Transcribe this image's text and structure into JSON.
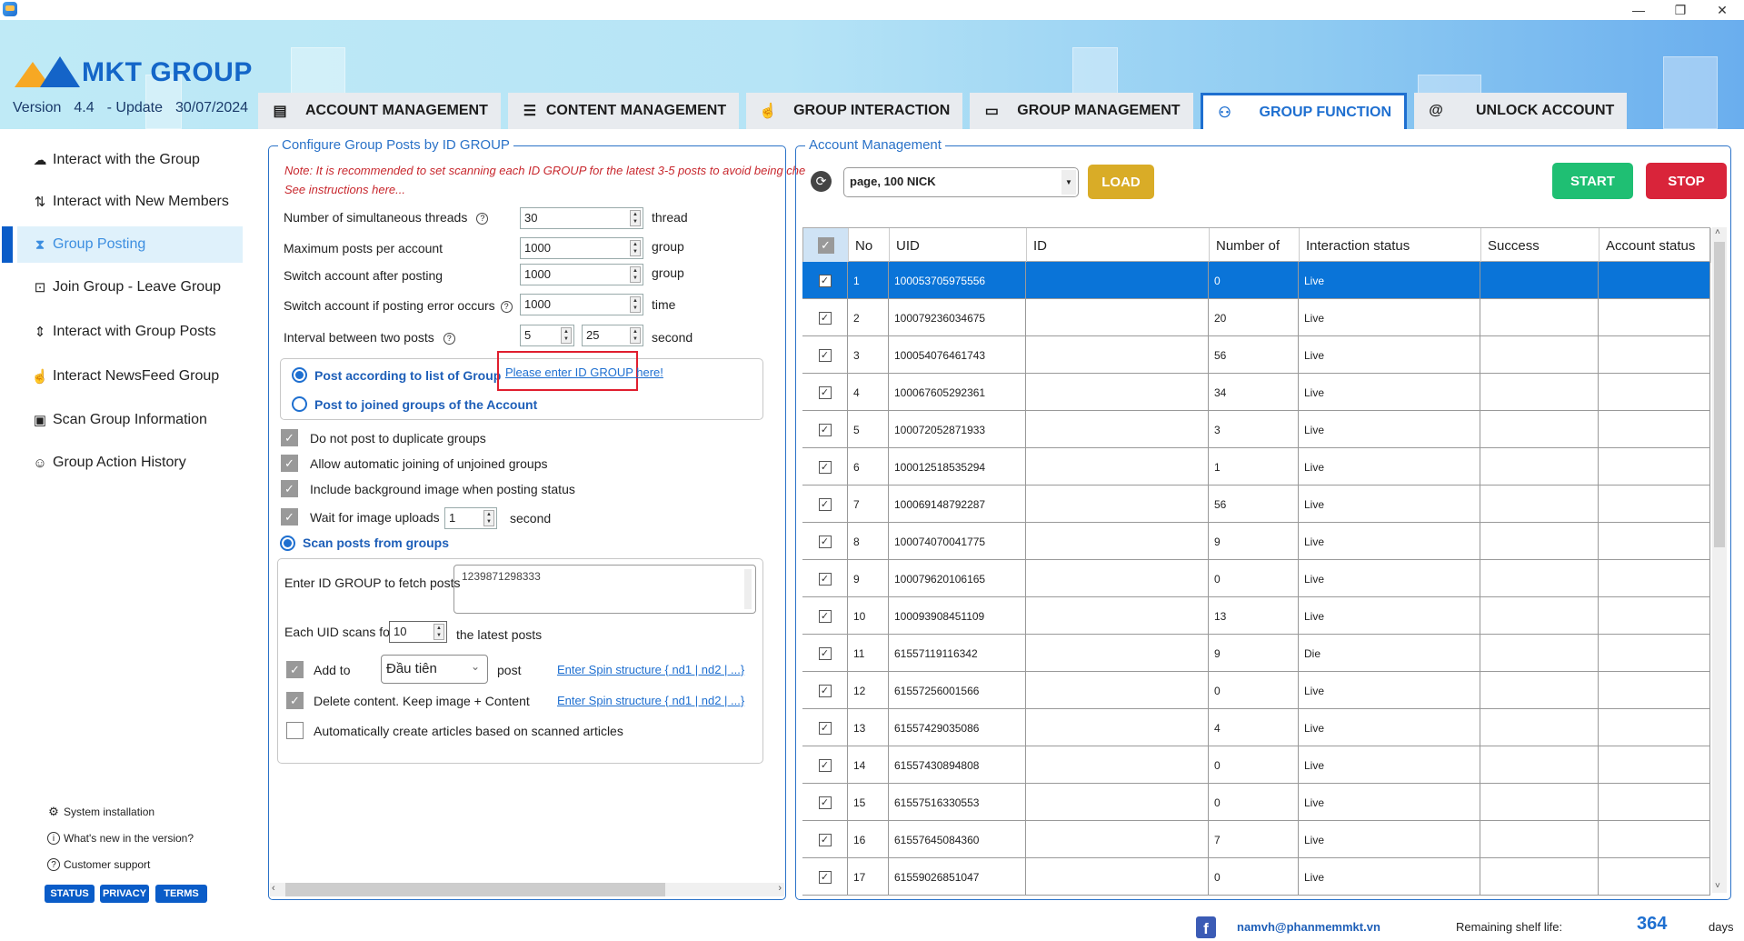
{
  "window": {
    "minimize": "—",
    "restore": "❐",
    "close": "✕"
  },
  "header": {
    "logo_text": "MKT GROUP",
    "version_label": "Version",
    "version": "4.4",
    "update_label": "- Update",
    "update_date": "30/07/2024"
  },
  "tabs": [
    {
      "label": "ACCOUNT MANAGEMENT",
      "icon": "▤"
    },
    {
      "label": "CONTENT MANAGEMENT",
      "icon": "☰"
    },
    {
      "label": "GROUP INTERACTION",
      "icon": "☝"
    },
    {
      "label": "GROUP MANAGEMENT",
      "icon": "▭"
    },
    {
      "label": "GROUP FUNCTION",
      "icon": "⚇",
      "active": true
    },
    {
      "label": "UNLOCK ACCOUNT",
      "icon": "@"
    }
  ],
  "sidebar": {
    "items": [
      {
        "label": "Interact with the Group",
        "icon": "☁"
      },
      {
        "label": "Interact with New Members",
        "icon": "⇅"
      },
      {
        "label": "Group Posting",
        "icon": "⧗",
        "active": true
      },
      {
        "label": "Join Group - Leave Group",
        "icon": "⊡"
      },
      {
        "label": "Interact with Group Posts",
        "icon": "⇕"
      },
      {
        "label": "Interact NewsFeed Group",
        "icon": "☝"
      },
      {
        "label": "Scan Group Information",
        "icon": "▣"
      },
      {
        "label": "Group Action History",
        "icon": "☺"
      }
    ],
    "footer": [
      {
        "label": "System installation",
        "icon": "⚙"
      },
      {
        "label": "What's new in the version?",
        "icon": "i"
      },
      {
        "label": "Customer support",
        "icon": "?"
      }
    ],
    "pills": [
      "STATUS",
      "PRIVACY",
      "TERMS"
    ]
  },
  "config": {
    "legend": "Configure Group Posts by ID GROUP",
    "note": "Note: It is recommended to set scanning each ID GROUP for the latest 3-5 posts to avoid being che",
    "instructions": "See instructions here...",
    "fields": {
      "threads": {
        "label": "Number of simultaneous threads",
        "value": "30",
        "unit": "thread"
      },
      "max_posts": {
        "label": "Maximum posts per account",
        "value": "1000",
        "unit": "group"
      },
      "switch_after": {
        "label": "Switch account after posting",
        "value": "1000",
        "unit": "group"
      },
      "switch_error": {
        "label": "Switch account if posting error occurs",
        "value": "1000",
        "unit": "time"
      },
      "interval": {
        "label": "Interval between two posts",
        "from": "5",
        "to": "25",
        "unit": "second"
      }
    },
    "post_mode": {
      "option1": "Post according to list of Group",
      "option2": "Post to joined groups of the Account",
      "enter_link": "Please enter ID GROUP here!",
      "selected": "option1"
    },
    "checks": {
      "no_duplicate": {
        "label": "Do not post to duplicate groups",
        "checked": true
      },
      "auto_join": {
        "label": "Allow automatic joining of unjoined groups",
        "checked": true
      },
      "bg_image": {
        "label": "Include background image when posting status",
        "checked": true
      },
      "wait_upload": {
        "label": "Wait for image uploads",
        "value": "1",
        "unit": "second",
        "checked": true
      }
    },
    "scan": {
      "label": "Scan posts from groups",
      "fetch_label": "Enter ID GROUP to fetch posts",
      "fetch_value": "1239871298333",
      "each_uid_label": "Each UID scans for",
      "each_uid_value": "10",
      "each_uid_unit": "the latest posts",
      "add_to_label": "Add to",
      "add_to_value": "Đầu tiên",
      "add_to_unit": "post",
      "spin_link": "Enter Spin structure { nd1 | nd2 | ...}",
      "delete_label": "Delete content. Keep image + Content",
      "auto_create_label": "Automatically create articles based on scanned articles"
    }
  },
  "accounts": {
    "legend": "Account Management",
    "dropdown_value": "page, 100 NICK",
    "load": "LOAD",
    "start": "START",
    "stop": "STOP",
    "colors": {
      "load": "#d9ac27",
      "start": "#1fbf73",
      "stop": "#d9243a",
      "selected_row": "#0a74d8"
    },
    "columns": [
      "",
      "No",
      "UID",
      "ID",
      "Number of",
      "Interaction status",
      "Success",
      "Account status"
    ],
    "rows": [
      {
        "no": "1",
        "uid": "100053705975556",
        "id": "",
        "count": "0",
        "status": "Live",
        "success": "",
        "account": "",
        "selected": true
      },
      {
        "no": "2",
        "uid": "100079236034675",
        "id": "",
        "count": "20",
        "status": "Live",
        "success": "",
        "account": ""
      },
      {
        "no": "3",
        "uid": "100054076461743",
        "id": "",
        "count": "56",
        "status": "Live",
        "success": "",
        "account": ""
      },
      {
        "no": "4",
        "uid": "100067605292361",
        "id": "",
        "count": "34",
        "status": "Live",
        "success": "",
        "account": ""
      },
      {
        "no": "5",
        "uid": "100072052871933",
        "id": "",
        "count": "3",
        "status": "Live",
        "success": "",
        "account": ""
      },
      {
        "no": "6",
        "uid": "100012518535294",
        "id": "",
        "count": "1",
        "status": "Live",
        "success": "",
        "account": ""
      },
      {
        "no": "7",
        "uid": "100069148792287",
        "id": "",
        "count": "56",
        "status": "Live",
        "success": "",
        "account": ""
      },
      {
        "no": "8",
        "uid": "100074070041775",
        "id": "",
        "count": "9",
        "status": "Live",
        "success": "",
        "account": ""
      },
      {
        "no": "9",
        "uid": "100079620106165",
        "id": "",
        "count": "0",
        "status": "Live",
        "success": "",
        "account": ""
      },
      {
        "no": "10",
        "uid": "100093908451109",
        "id": "",
        "count": "13",
        "status": "Live",
        "success": "",
        "account": ""
      },
      {
        "no": "11",
        "uid": "61557119116342",
        "id": "",
        "count": "9",
        "status": "Die",
        "success": "",
        "account": ""
      },
      {
        "no": "12",
        "uid": "61557256001566",
        "id": "",
        "count": "0",
        "status": "Live",
        "success": "",
        "account": ""
      },
      {
        "no": "13",
        "uid": "61557429035086",
        "id": "",
        "count": "4",
        "status": "Live",
        "success": "",
        "account": ""
      },
      {
        "no": "14",
        "uid": "61557430894808",
        "id": "",
        "count": "0",
        "status": "Live",
        "success": "",
        "account": ""
      },
      {
        "no": "15",
        "uid": "61557516330553",
        "id": "",
        "count": "0",
        "status": "Live",
        "success": "",
        "account": ""
      },
      {
        "no": "16",
        "uid": "61557645084360",
        "id": "",
        "count": "7",
        "status": "Live",
        "success": "",
        "account": ""
      },
      {
        "no": "17",
        "uid": "61559026851047",
        "id": "",
        "count": "0",
        "status": "Live",
        "success": "",
        "account": ""
      }
    ]
  },
  "footer": {
    "email": "namvh@phanmemmkt.vn",
    "shelf_label": "Remaining shelf life:",
    "shelf_days": "364",
    "days_label": "days"
  }
}
